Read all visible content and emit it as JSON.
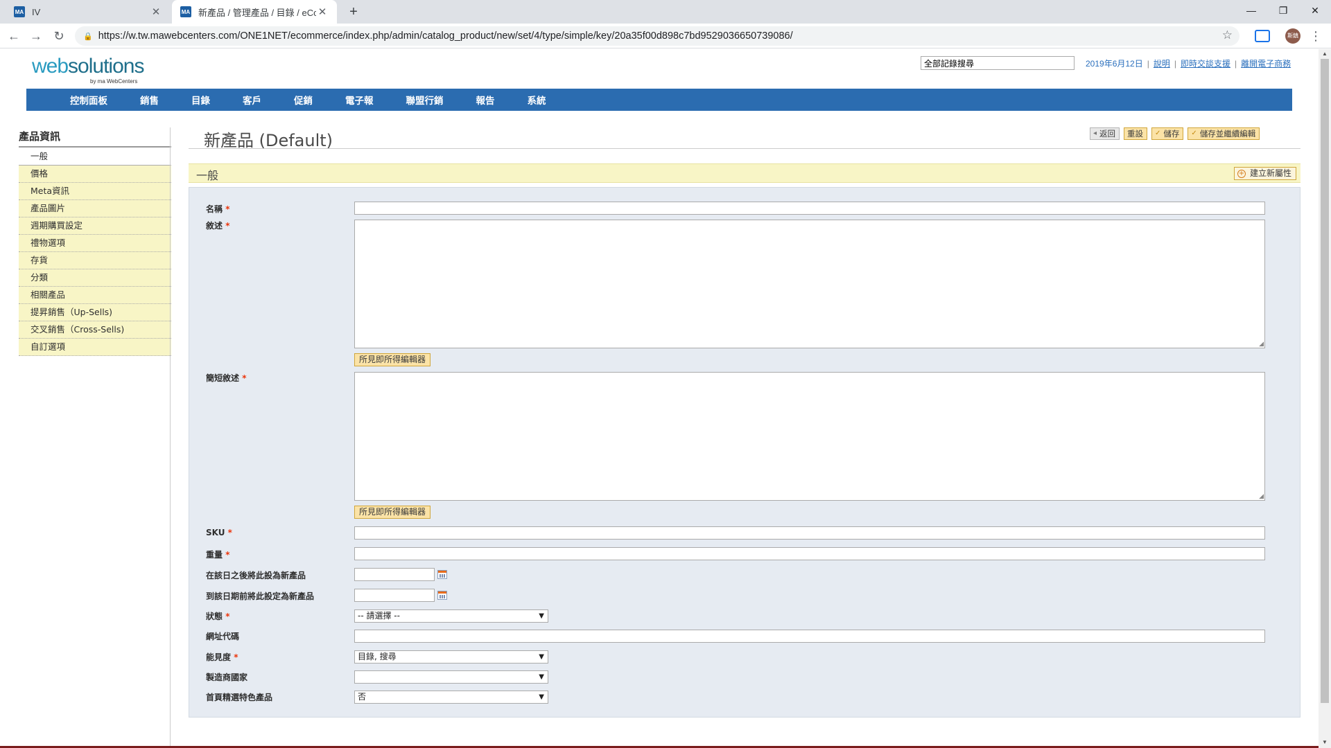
{
  "browser": {
    "tabs": [
      {
        "favicon": "MA",
        "title": "IV"
      },
      {
        "favicon": "MA",
        "title": "新產品 / 管理產品 / 目錄 / eCom"
      }
    ],
    "url": "https://w.tw.mawebcenters.com/ONE1NET/ecommerce/index.php/admin/catalog_product/new/set/4/type/simple/key/20a35f00d898c7bd9529036650739086/",
    "profile_initials": "斯鎮",
    "icons": {
      "back": "arrow-left-icon",
      "forward": "arrow-right-icon",
      "reload": "reload-icon",
      "lock": "lock-icon",
      "star": "star-icon"
    }
  },
  "header": {
    "logo_web": "web",
    "logo_solutions": "solutions",
    "logo_sub": "by ma WebCenters",
    "search_value": "全部記錄搜尋",
    "date": "2019年6月12日",
    "links": [
      "說明",
      "即時交談支援",
      "離開電子商務"
    ]
  },
  "nav": {
    "items": [
      "控制面板",
      "銷售",
      "目錄",
      "客戶",
      "促銷",
      "電子報",
      "聯盟行銷",
      "報告",
      "系統"
    ]
  },
  "sidebar": {
    "title": "產品資訊",
    "items": [
      "一般",
      "價格",
      "Meta資訊",
      "產品圖片",
      "週期購買設定",
      "禮物選項",
      "存貨",
      "分類",
      "相關產品",
      "提昇銷售（Up-Sells)",
      "交叉銷售（Cross-Sells)",
      "自訂選項"
    ]
  },
  "content": {
    "title": "新產品 (Default)",
    "actions": {
      "back": "返回",
      "reset": "重設",
      "save": "儲存",
      "save_continue": "儲存並繼續編輯"
    },
    "section_title": "一般",
    "new_attribute": "建立新屬性"
  },
  "form": {
    "required_mark": "*",
    "name_label": "名稱",
    "description_label": "敘述",
    "short_description_label": "簡短敘述",
    "wysiwyg_label": "所見即所得編輯器",
    "sku_label": "SKU",
    "weight_label": "重量",
    "news_from_label": "在該日之後將此設為新產品",
    "news_to_label": "到該日期前將此設定為新產品",
    "status_label": "狀態",
    "status_value": "-- 請選擇 --",
    "url_key_label": "網址代碼",
    "visibility_label": "能見度",
    "visibility_value": "目錄, 搜尋",
    "country_label": "製造商國家",
    "country_value": "",
    "featured_label": "首頁精選特色產品",
    "featured_value": "否"
  }
}
